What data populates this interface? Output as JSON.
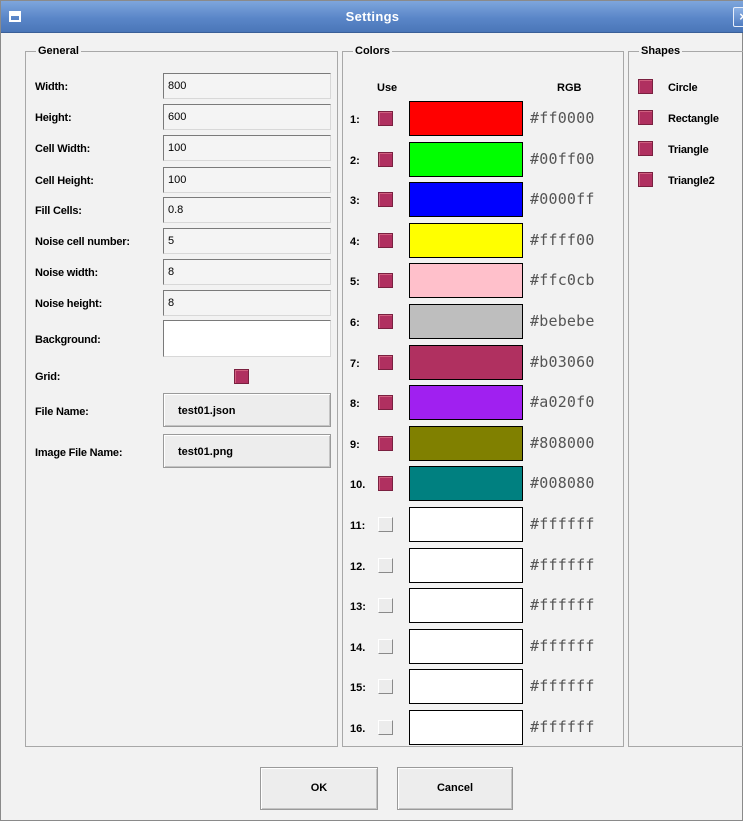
{
  "window": {
    "title": "Settings",
    "close_glyph": "×",
    "icon": "window-icon"
  },
  "general": {
    "title": "General",
    "width": {
      "label": "Width:",
      "value": "800"
    },
    "height": {
      "label": "Height:",
      "value": "600"
    },
    "cell_width": {
      "label": "Cell Width:",
      "value": "100"
    },
    "cell_height": {
      "label": "Cell Height:",
      "value": "100"
    },
    "fill_cells": {
      "label": "Fill Cells:",
      "value": "0.8"
    },
    "noise_cell_number": {
      "label": "Noise cell number:",
      "value": "5"
    },
    "noise_width": {
      "label": "Noise width:",
      "value": "8"
    },
    "noise_height": {
      "label": "Noise height:",
      "value": "8"
    },
    "background": {
      "label": "Background:",
      "color": "#ffffff"
    },
    "grid": {
      "label": "Grid:",
      "checked": true
    },
    "file_name": {
      "label": "File Name:",
      "value": "test01.json"
    },
    "image_file_name": {
      "label": "Image File Name:",
      "value": "test01.png"
    }
  },
  "colors": {
    "title": "Colors",
    "use_header": "Use",
    "rgb_header": "RGB",
    "rows": [
      {
        "label": "1:",
        "use": true,
        "rgb": "#ff0000"
      },
      {
        "label": "2:",
        "use": true,
        "rgb": "#00ff00"
      },
      {
        "label": "3:",
        "use": true,
        "rgb": "#0000ff"
      },
      {
        "label": "4:",
        "use": true,
        "rgb": "#ffff00"
      },
      {
        "label": "5:",
        "use": true,
        "rgb": "#ffc0cb"
      },
      {
        "label": "6:",
        "use": true,
        "rgb": "#bebebe"
      },
      {
        "label": "7:",
        "use": true,
        "rgb": "#b03060"
      },
      {
        "label": "8:",
        "use": true,
        "rgb": "#a020f0"
      },
      {
        "label": "9:",
        "use": true,
        "rgb": "#808000"
      },
      {
        "label": "10.",
        "use": true,
        "rgb": "#008080"
      },
      {
        "label": "11:",
        "use": false,
        "rgb": "#ffffff"
      },
      {
        "label": "12.",
        "use": false,
        "rgb": "#ffffff"
      },
      {
        "label": "13:",
        "use": false,
        "rgb": "#ffffff"
      },
      {
        "label": "14.",
        "use": false,
        "rgb": "#ffffff"
      },
      {
        "label": "15:",
        "use": false,
        "rgb": "#ffffff"
      },
      {
        "label": "16.",
        "use": false,
        "rgb": "#ffffff"
      }
    ]
  },
  "shapes": {
    "title": "Shapes",
    "items": [
      {
        "label": "Circle",
        "checked": true
      },
      {
        "label": "Rectangle",
        "checked": true
      },
      {
        "label": "Triangle",
        "checked": true
      },
      {
        "label": "Triangle2",
        "checked": true
      }
    ]
  },
  "buttons": {
    "ok": "OK",
    "cancel": "Cancel"
  },
  "theme": {
    "checked_color": "#b03060",
    "titlebar_color": "#5a86c8"
  }
}
